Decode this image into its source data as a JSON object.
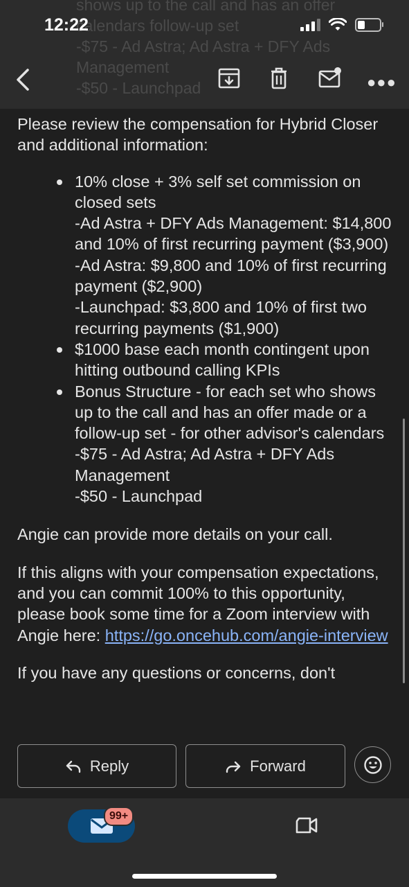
{
  "status_bar": {
    "time": "12:22"
  },
  "ghost_text": [
    "shows up to the call and has an offer",
    "calendars follow-up set",
    "-$75 - Ad Astra; Ad Astra + DFY Ads",
    "Management",
    "-$50 - Launchpad"
  ],
  "email": {
    "intro": "Please review the compensation for Hybrid Closer and additional information:",
    "bullets": [
      {
        "lines": [
          "10% close + 3% self set commission on closed sets",
          "-Ad Astra + DFY Ads Management: $14,800 and 10% of first recurring payment ($3,900)",
          "-Ad Astra: $9,800 and 10% of first recurring payment ($2,900)",
          "-Launchpad: $3,800 and 10% of first two recurring payments ($1,900)"
        ]
      },
      {
        "lines": [
          "$1000 base each month contingent upon hitting outbound calling KPIs"
        ]
      },
      {
        "lines": [
          "Bonus Structure - for each set who shows up to the call and has an offer made or a follow-up set - for other advisor's calendars",
          "-$75 - Ad Astra; Ad Astra + DFY Ads Management",
          "-$50 - Launchpad"
        ]
      }
    ],
    "para_details": "Angie can provide more details on your call.",
    "para_book": "If this aligns with your compensation expectations, and you can commit 100% to this opportunity, please book some time for a Zoom interview with Angie here: ",
    "link_text": "https://go.oncehub.com/angie-interview",
    "cutoff_text": "If you have any questions or concerns, don't"
  },
  "actions": {
    "reply_label": "Reply",
    "forward_label": "Forward"
  },
  "nav": {
    "mail_badge": "99+"
  },
  "colors": {
    "link": "#8ab4f8",
    "badge": "#f28b82",
    "mail_pill": "#0b4a7a"
  },
  "icons": [
    "back-arrow-icon",
    "archive-icon",
    "trash-icon",
    "mark-unread-icon",
    "more-icon",
    "reply-icon",
    "forward-icon",
    "emoji-icon",
    "mail-icon",
    "meet-icon"
  ]
}
